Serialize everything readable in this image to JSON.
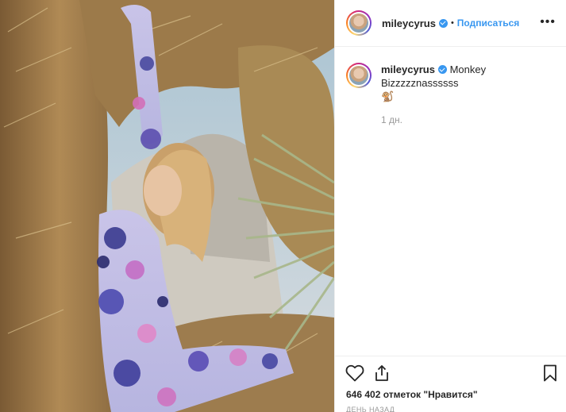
{
  "post": {
    "username": "mileycyrus",
    "follow_label": "Подписаться",
    "dot": "•",
    "more": "•••",
    "caption_text": "Monkey Bizzzzznassssss",
    "caption_emoji": "🐒",
    "caption_time": "1 дн.",
    "likes_text": "646 402 отметок \"Нравится\"",
    "time_ago": "ДЕНЬ НАЗАД"
  },
  "icons": {
    "like": "heart-outline-icon",
    "share": "share-upload-icon",
    "save": "bookmark-outline-icon",
    "verified": "verified-badge-icon",
    "more": "more-options-icon"
  },
  "colors": {
    "link": "#3897f0",
    "text": "#262626",
    "muted": "#999999",
    "divider": "#efefef"
  }
}
